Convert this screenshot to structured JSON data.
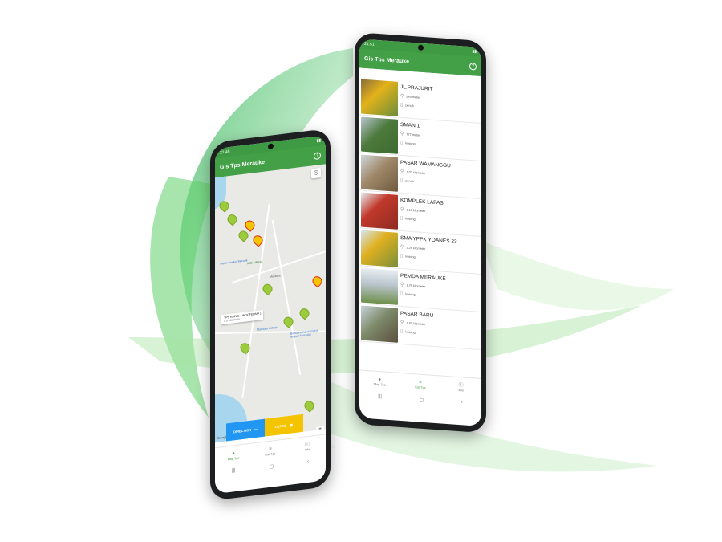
{
  "colors": {
    "primary_green": "#43a047",
    "direction_blue": "#2196f3",
    "detail_yellow": "#f5c400"
  },
  "left_phone": {
    "status": {
      "time": "21.45"
    },
    "app_title": "Gis Tps Merauke",
    "help_icon": "?",
    "map": {
      "locate_icon": "gps-fixed-icon",
      "labels": {
        "supermarket": "Super market Merauk",
        "igo_libra": "IGO LIBRA",
        "merauke": "Merauke",
        "mandala": "Mandala Kabupa",
        "airport": "Bandara Internasional Mopah Merauke"
      },
      "callout": {
        "title": "TPS KAPLE ( INDOFERMA )",
        "subtitle": "0.9 kilometer"
      },
      "direction_label": "DIRECTION",
      "detail_label": "DETAIL",
      "zoom_in": "+",
      "zoom_out": "−",
      "google": "Google"
    },
    "nav": [
      {
        "label": "Map Tps",
        "icon": "map-pin-icon",
        "active": true
      },
      {
        "label": "List Tps",
        "icon": "list-icon",
        "active": false
      },
      {
        "label": "Info",
        "icon": "info-icon",
        "active": false
      }
    ]
  },
  "right_phone": {
    "status": {
      "time": "21.51"
    },
    "app_title": "Gis Tps Merauke",
    "help_icon": "?",
    "items": [
      {
        "title": "JL.PRAJURIT",
        "distance": "944 meter",
        "status": "penuh"
      },
      {
        "title": "SMAN 1",
        "distance": "777 meter",
        "status": "kosong"
      },
      {
        "title": "PASAR WAMANGGU",
        "distance": "1,02 kilometer",
        "status": "penuh"
      },
      {
        "title": "KOMPLEK LAPAS",
        "distance": "1,18 kilometer",
        "status": "kosong"
      },
      {
        "title": "SMA YPPK YOANES 23",
        "distance": "1,25 kilometer",
        "status": "kosong"
      },
      {
        "title": "PEMDA MERAUKE",
        "distance": "1,79 kilometer",
        "status": "kosong"
      },
      {
        "title": "PASAR BARU",
        "distance": "1,83 kilometer",
        "status": "kosong"
      }
    ],
    "nav": [
      {
        "label": "Map Tps",
        "icon": "map-pin-icon",
        "active": false
      },
      {
        "label": "List Tps",
        "icon": "list-icon",
        "active": true
      },
      {
        "label": "Info",
        "icon": "info-icon",
        "active": false
      }
    ]
  }
}
